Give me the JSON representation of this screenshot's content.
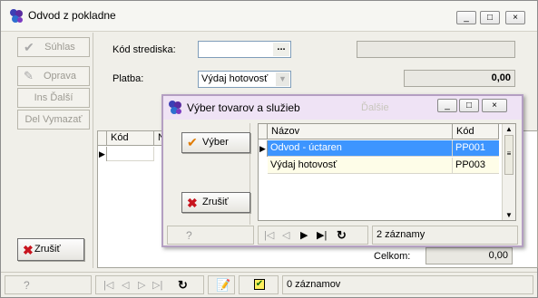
{
  "window": {
    "title": "Odvod z pokladne",
    "controls": [
      "_",
      "□",
      "×"
    ]
  },
  "sidebar": {
    "suhlas_label": "Súhlas",
    "oprava_label": "Oprava",
    "ins_label": "Ins Ďalší",
    "del_label": "Del Vymazať",
    "zrusit_label": "Zrušiť"
  },
  "form": {
    "kod_strediska_label": "Kód strediska:",
    "kod_strediska_value": "",
    "dots_label": "...",
    "platba_label": "Platba:",
    "platba_value": "Výdaj hotovosť",
    "amount_value": "0,00"
  },
  "grid": {
    "columns": [
      "Kód",
      "N"
    ]
  },
  "totals": {
    "celkom_label": "Celkom:",
    "celkom_value": "0,00"
  },
  "statusbar": {
    "help": "?",
    "records": "0 záznamov"
  },
  "dialog": {
    "title": "Výber tovarov a služieb",
    "hidden_btn_label": "Ďalšie",
    "vyber_label": "Výber",
    "zrusit_label": "Zrušiť",
    "columns": [
      "Názov",
      "Kód"
    ],
    "rows": [
      {
        "nazov": "Odvod - úctaren",
        "kod": "PP001"
      },
      {
        "nazov": "Výdaj hotovosť",
        "kod": "PP003"
      }
    ],
    "records": "2 záznamy",
    "help": "?"
  },
  "colors": {
    "selected_row": "#3d95ff",
    "alt_row": "#fefde8",
    "dialog_border": "#b49fc2",
    "cancel_icon": "#c8141e",
    "check_icon": "#e07a00"
  }
}
